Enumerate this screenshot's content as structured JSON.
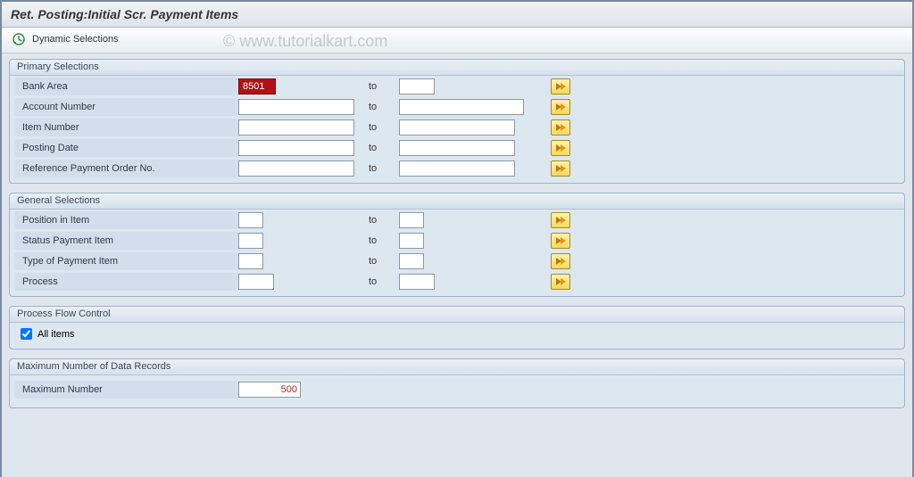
{
  "window": {
    "title": "Ret. Posting:Initial Scr. Payment Items"
  },
  "toolbar": {
    "dynamic_selections": "Dynamic Selections"
  },
  "watermark": "© www.tutorialkart.com",
  "groups": {
    "primary": {
      "title": "Primary Selections",
      "rows": {
        "bank_area": {
          "label": "Bank Area",
          "from": "8501",
          "to": "",
          "to_label": "to"
        },
        "account_number": {
          "label": "Account Number",
          "from": "",
          "to": "",
          "to_label": "to"
        },
        "item_number": {
          "label": "Item Number",
          "from": "",
          "to": "",
          "to_label": "to"
        },
        "posting_date": {
          "label": "Posting Date",
          "from": "",
          "to": "",
          "to_label": "to"
        },
        "ref_order": {
          "label": "Reference Payment Order No.",
          "from": "",
          "to": "",
          "to_label": "to"
        }
      }
    },
    "general": {
      "title": "General Selections",
      "rows": {
        "position": {
          "label": "Position in Item",
          "from": "",
          "to": "",
          "to_label": "to"
        },
        "status": {
          "label": "Status Payment Item",
          "from": "",
          "to": "",
          "to_label": "to"
        },
        "type": {
          "label": "Type of Payment Item",
          "from": "",
          "to": "",
          "to_label": "to"
        },
        "process": {
          "label": "Process",
          "from": "",
          "to": "",
          "to_label": "to"
        }
      }
    },
    "flow": {
      "title": "Process Flow Control",
      "all_items": {
        "label": "All items",
        "checked": true
      }
    },
    "max": {
      "title": "Maximum Number of Data Records",
      "row": {
        "label": "Maximum Number",
        "value": "500"
      }
    }
  }
}
